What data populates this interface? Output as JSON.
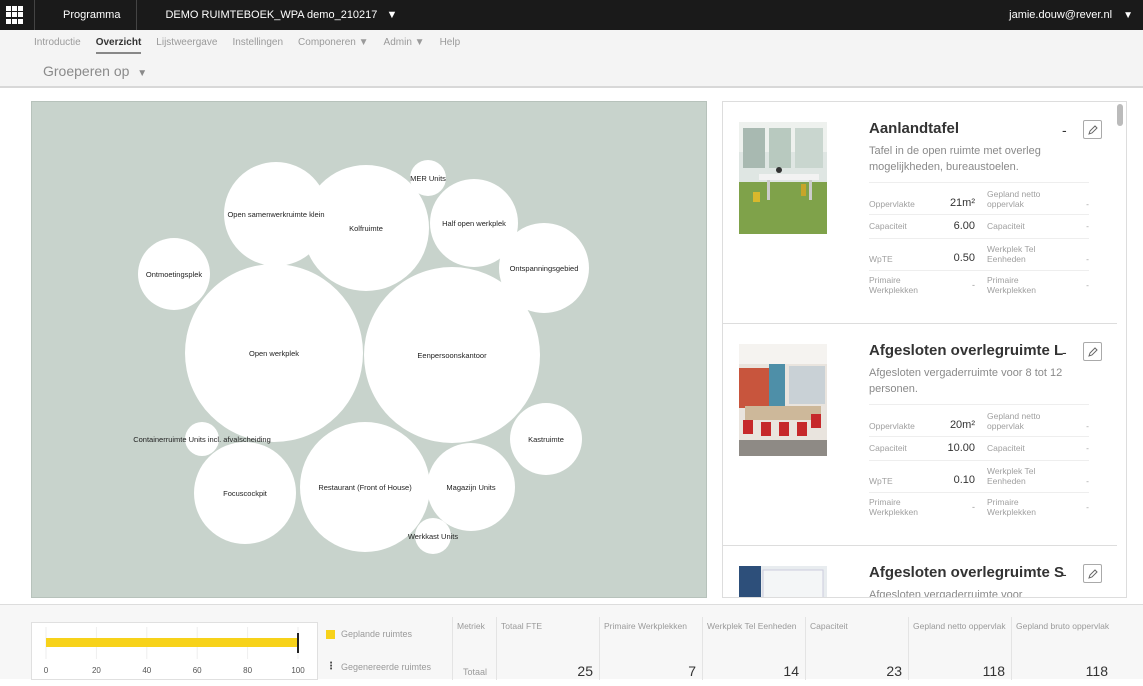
{
  "topbar": {
    "program_label": "Programma",
    "demo_title": "DEMO RUIMTEBOEK_WPA demo_210217",
    "user": "jamie.douw@rever.nl",
    "caret": "▼"
  },
  "nav": {
    "tabs": [
      "Introductie",
      "Overzicht",
      "Lijstweergave",
      "Instellingen",
      "Componeren ▼",
      "Admin ▼",
      "Help"
    ],
    "active_tab": "Overzicht",
    "groupby_label": "Groeperen op",
    "groupby_caret": "▼"
  },
  "bubbles": [
    {
      "label": "Open samenwerkruimte klein"
    },
    {
      "label": "Kolfruimte"
    },
    {
      "label": "MER Units"
    },
    {
      "label": "Half open werkplek"
    },
    {
      "label": "Ontspanningsgebied"
    },
    {
      "label": "Ontmoetingsplek"
    },
    {
      "label": "Open werkplek"
    },
    {
      "label": "Eenpersoonskantoor"
    },
    {
      "label": "Containerruimte Units incl. afvalscheiding"
    },
    {
      "label": "Kastruimte"
    },
    {
      "label": "Focuscockpit"
    },
    {
      "label": "Restaurant (Front of House)"
    },
    {
      "label": "Magazijn Units"
    },
    {
      "label": "Werkkast Units"
    }
  ],
  "cards": [
    {
      "title": "Aanlandtafel",
      "dash": "-",
      "desc": "Tafel in de open ruimte met overleg mogelijkheden, bureaustoelen.",
      "oppervlakte_label": "Oppervlakte",
      "oppervlakte": "21m²",
      "gepland_label": "Gepland netto oppervlak",
      "gepland": "-",
      "capaciteit_label": "Capaciteit",
      "capaciteit": "6.00",
      "capaciteit2_label": "Capaciteit",
      "capaciteit2": "-",
      "wpte_label": "WpTE",
      "wpte": "0.50",
      "werkplek_label": "Werkplek Tel Eenheden",
      "werkplek": "-",
      "primaire_label": "Primaire Werkplekken",
      "primaire": "-",
      "primaire2_label": "Primaire Werkplekken",
      "primaire2": "-"
    },
    {
      "title": "Afgesloten overlegruimte L",
      "dash": "-",
      "desc": "Afgesloten vergaderruimte voor 8 tot 12 personen.",
      "oppervlakte_label": "Oppervlakte",
      "oppervlakte": "20m²",
      "gepland_label": "Gepland netto oppervlak",
      "gepland": "-",
      "capaciteit_label": "Capaciteit",
      "capaciteit": "10.00",
      "capaciteit2_label": "Capaciteit",
      "capaciteit2": "-",
      "wpte_label": "WpTE",
      "wpte": "0.10",
      "werkplek_label": "Werkplek Tel Eenheden",
      "werkplek": "-",
      "primaire_label": "Primaire Werkplekken",
      "primaire": "-",
      "primaire2_label": "Primaire Werkplekken",
      "primaire2": "-"
    },
    {
      "title": "Afgesloten overlegruimte S",
      "dash": "-",
      "desc": "Afgesloten vergaderruimte voor"
    }
  ],
  "mini_chart": {
    "ticks": [
      "0",
      "20",
      "40",
      "60",
      "80",
      "100"
    ],
    "value": 100
  },
  "legend": {
    "planned": "Geplande ruimtes",
    "generated": "Gegenereerde ruimtes",
    "planned_color": "#f7d21a"
  },
  "metrics": {
    "metric_label": "Metriek",
    "total_label": "Totaal",
    "columns": [
      {
        "head": "Totaal FTE",
        "value": "25"
      },
      {
        "head": "Primaire Werkplekken",
        "value": "7"
      },
      {
        "head": "Werkplek Tel Eenheden",
        "value": "14"
      },
      {
        "head": "Capaciteit",
        "value": "23"
      },
      {
        "head": "Gepland netto oppervlak",
        "value": "118"
      },
      {
        "head": "Gepland bruto oppervlak",
        "value": "118"
      }
    ]
  }
}
